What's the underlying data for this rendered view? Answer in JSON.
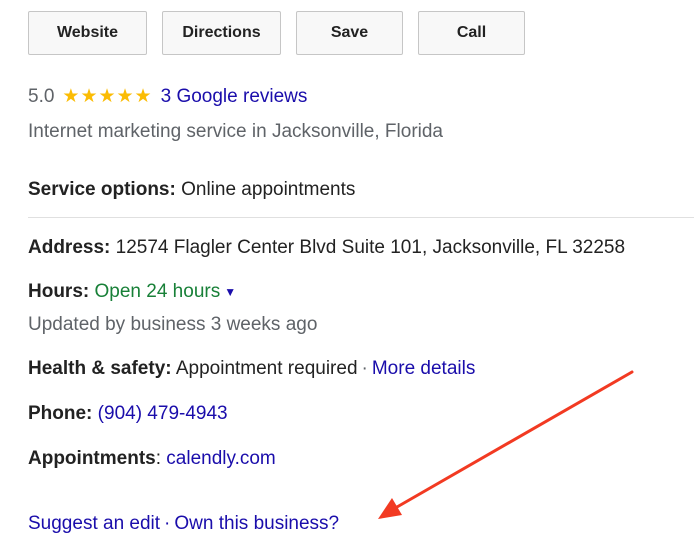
{
  "buttons": {
    "website": "Website",
    "directions": "Directions",
    "save": "Save",
    "call": "Call"
  },
  "rating": {
    "value": "5.0",
    "stars": "★★★★★",
    "star_count": 5,
    "reviews_link": "3 Google reviews",
    "star_color": "#fbbc04"
  },
  "category": "Internet marketing service in Jacksonville, Florida",
  "service_options": {
    "label": "Service options:",
    "value": "Online appointments"
  },
  "address": {
    "label": "Address:",
    "value": "12574 Flagler Center Blvd Suite 101, Jacksonville, FL 32258"
  },
  "hours": {
    "label": "Hours:",
    "value": "Open 24 hours",
    "caret": "▼",
    "updated": "Updated by business 3 weeks ago",
    "status_color": "#188038"
  },
  "health_safety": {
    "label": "Health & safety:",
    "value": "Appointment required",
    "separator": "·",
    "link": "More details"
  },
  "phone": {
    "label": "Phone:",
    "value": "(904) 479-4943"
  },
  "appointments": {
    "label": "Appointments",
    "colon": ":",
    "link": "calendly.com"
  },
  "footer_links": {
    "suggest_edit": "Suggest an edit",
    "separator": "·",
    "own_business": "Own this business?"
  },
  "colors": {
    "link": "#1a0dab",
    "annotation_arrow": "#f23a22"
  }
}
